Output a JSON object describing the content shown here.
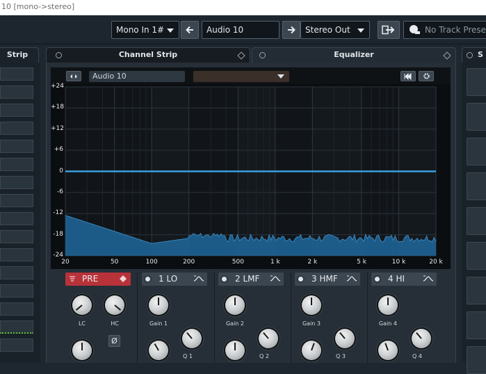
{
  "window": {
    "title": "10 [mono->stereo]"
  },
  "toolbar": {
    "input_routing": "Mono In 1#",
    "track_name": "Audio 10",
    "output_routing": "Stereo Out",
    "preset": "No Track Preset"
  },
  "panels": {
    "left_title": "Strip",
    "channel_strip_title": "Channel Strip",
    "equalizer_title": "Equalizer",
    "right_title": "S"
  },
  "eq": {
    "channel_name": "Audio 10",
    "y_ticks": [
      "+24",
      "+18",
      "+12",
      "+6",
      "0",
      "-6",
      "-12",
      "-18",
      "-24"
    ],
    "x_ticks": [
      "20",
      "50",
      "100",
      "200",
      "500",
      "1 k",
      "2 k",
      "5 k",
      "10 k",
      "20 k"
    ],
    "curve_gain_db": 0,
    "colors": {
      "curve": "#3b9fe0",
      "spectrum": "#1d5f8e",
      "pre_button": "#b8323a",
      "band_button": "#3b4650"
    }
  },
  "pre": {
    "label": "PRE",
    "lc_label": "LC",
    "hc_label": "HC",
    "phase_symbol": "Ø"
  },
  "bands": [
    {
      "label": "1 LO",
      "gain_label": "Gain 1",
      "q_label": "Q 1"
    },
    {
      "label": "2 LMF",
      "gain_label": "Gain 2",
      "q_label": "Q 2"
    },
    {
      "label": "3 HMF",
      "gain_label": "Gain 3",
      "q_label": "Q 3"
    },
    {
      "label": "4 HI",
      "gain_label": "Gain 4",
      "q_label": "Q 4"
    }
  ],
  "icons": [
    "arrow-left-icon",
    "arrow-right-icon",
    "route-icon",
    "preset-icon",
    "snapshot-icon",
    "settings-gear-icon",
    "power-icon",
    "filter-shape-icon"
  ]
}
